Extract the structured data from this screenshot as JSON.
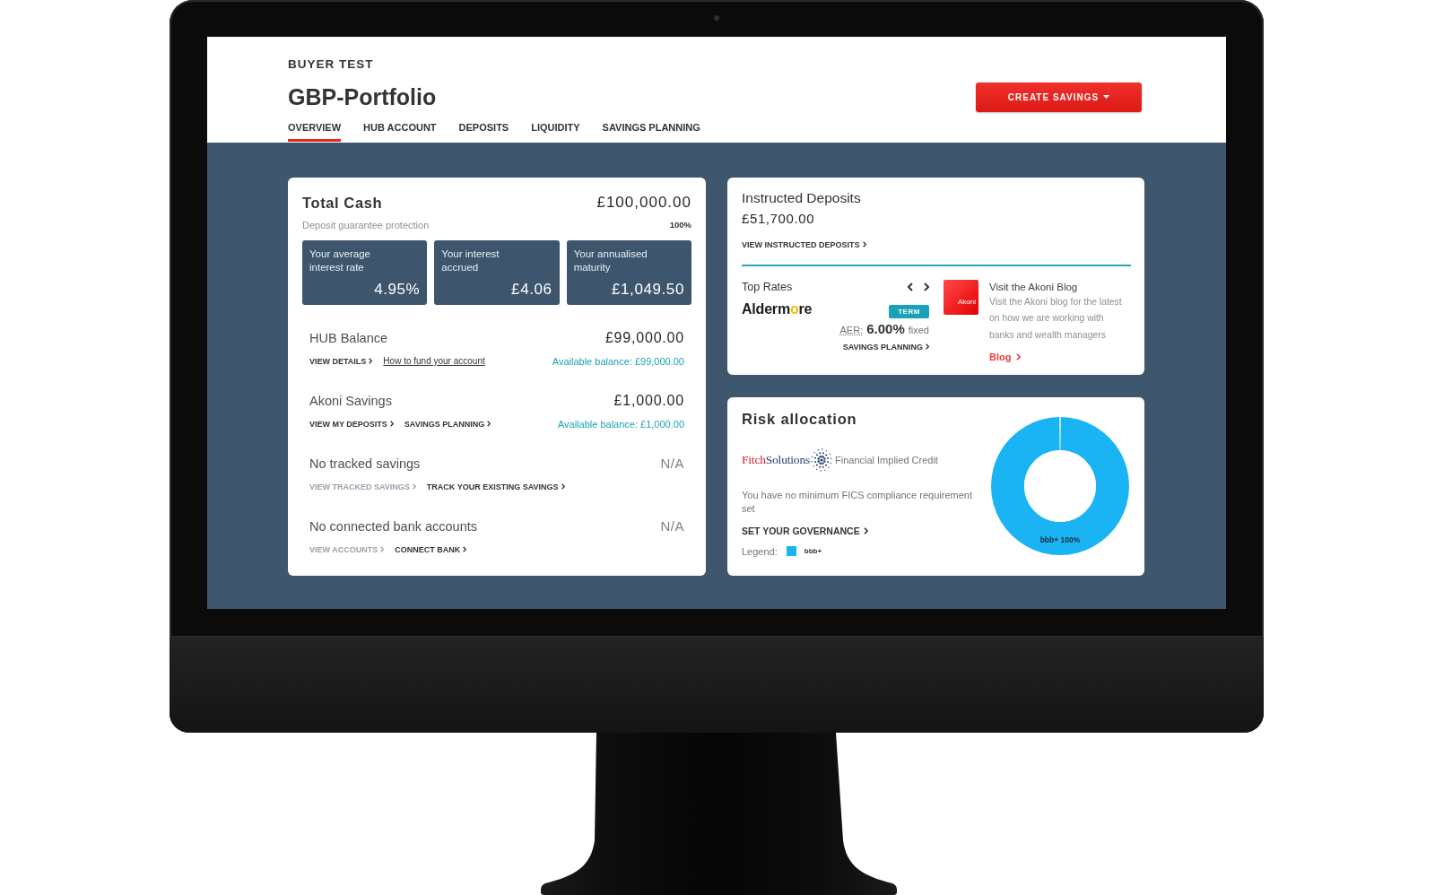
{
  "header": {
    "account_name": "BUYER TEST",
    "portfolio_title": "GBP-Portfolio",
    "create_button": {
      "label": "CREATE SAVINGS"
    },
    "tabs": [
      {
        "label": "OVERVIEW",
        "selected": true
      },
      {
        "label": "HUB ACCOUNT",
        "selected": false
      },
      {
        "label": "DEPOSITS",
        "selected": false
      },
      {
        "label": "LIQUIDITY",
        "selected": false
      },
      {
        "label": "SAVINGS PLANNING",
        "selected": false
      }
    ]
  },
  "total_cash": {
    "title": "Total Cash",
    "amount": "£100,000.00",
    "protection_label": "Deposit guarantee protection",
    "protection_value": "100%",
    "tiles": [
      {
        "label": "Your average interest rate",
        "value": "4.95%"
      },
      {
        "label": "Your interest accrued",
        "value": "£4.06"
      },
      {
        "label": "Your annualised maturity",
        "value": "£1,049.50"
      }
    ],
    "accounts": [
      {
        "kind": "balance",
        "title": "HUB Balance",
        "amount": "£99,000.00",
        "available": "Available balance: £99,000.00",
        "links": [
          {
            "kind": "chevron",
            "label": "VIEW DETAILS",
            "disabled": false
          },
          {
            "kind": "underlined",
            "label": "How to fund your account",
            "disabled": false
          }
        ]
      },
      {
        "kind": "balance",
        "title": "Akoni Savings",
        "amount": "£1,000.00",
        "available": "Available balance: £1,000.00",
        "links": [
          {
            "kind": "chevron",
            "label": "VIEW MY DEPOSITS",
            "disabled": false
          },
          {
            "kind": "chevron",
            "label": "SAVINGS PLANNING",
            "disabled": false
          }
        ]
      },
      {
        "kind": "empty",
        "title": "No tracked savings",
        "amount": "N/A",
        "links": [
          {
            "kind": "chevron",
            "label": "VIEW TRACKED SAVINGS",
            "disabled": true
          },
          {
            "kind": "chevron",
            "label": "TRACK YOUR EXISTING SAVINGS",
            "disabled": false
          }
        ]
      },
      {
        "kind": "empty",
        "title": "No connected bank accounts",
        "amount": "N/A",
        "links": [
          {
            "kind": "chevron",
            "label": "VIEW ACCOUNTS",
            "disabled": true
          },
          {
            "kind": "chevron",
            "label": "CONNECT BANK",
            "disabled": false
          }
        ]
      }
    ]
  },
  "instructed_deposits": {
    "title": "Instructed Deposits",
    "amount": "£51,700.00",
    "link": "VIEW INSTRUCTED DEPOSITS",
    "top_rates": {
      "title": "Top Rates",
      "bank_logo": "Aldermore",
      "product_type": "TERM",
      "rate_label": "AER:",
      "rate": "6.00%",
      "rate_type": "fixed",
      "link": "SAVINGS PLANNING"
    },
    "blog": {
      "logo_text": "Akoni",
      "title": "Visit the Akoni Blog",
      "description": "Visit the Akoni blog for the latest on how we are working with banks and wealth managers",
      "link": "Blog"
    }
  },
  "risk_allocation": {
    "title": "Risk allocation",
    "provider_wordmark": [
      "Fitch",
      "Solutions"
    ],
    "provider_caption": "Financial Implied Credit",
    "message": "You have no minimum FICS compliance requirement set",
    "link": "SET YOUR GOVERNANCE",
    "legend_label": "Legend:",
    "chart_data": {
      "type": "donut",
      "categories": [
        "bbb+"
      ],
      "series": [
        {
          "color": "#1ab4f5",
          "values": [
            100
          ]
        }
      ],
      "value_labels": [
        "bbb+ 100%"
      ]
    }
  }
}
